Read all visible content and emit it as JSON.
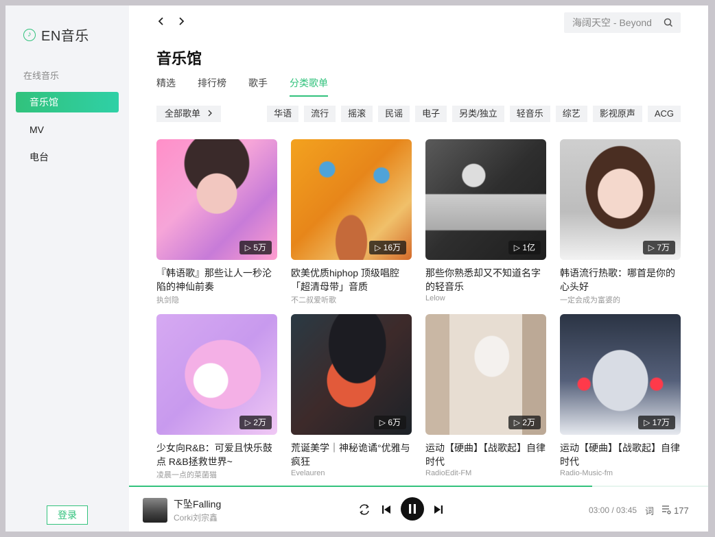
{
  "app": {
    "name": "EN音乐",
    "logo_icon": "music-note-icon"
  },
  "sidebar": {
    "section_label": "在线音乐",
    "items": [
      {
        "label": "音乐馆",
        "active": true
      },
      {
        "label": "MV",
        "active": false
      },
      {
        "label": "电台",
        "active": false
      }
    ],
    "login_label": "登录"
  },
  "header": {
    "back_icon": "chevron-left-icon",
    "forward_icon": "chevron-right-icon",
    "search_placeholder": "海阔天空 - Beyond",
    "search_icon": "search-icon"
  },
  "page": {
    "title": "音乐馆",
    "tabs": [
      {
        "label": "精选",
        "active": false
      },
      {
        "label": "排行榜",
        "active": false
      },
      {
        "label": "歌手",
        "active": false
      },
      {
        "label": "分类歌单",
        "active": true
      }
    ],
    "all_button_label": "全部歌单",
    "tags": [
      "华语",
      "流行",
      "摇滚",
      "民谣",
      "电子",
      "另类/独立",
      "轻音乐",
      "综艺",
      "影视原声",
      "ACG"
    ]
  },
  "playlists": [
    {
      "title": "『韩语歌』那些让人一秒沦陷的神仙前奏",
      "author": "执剑隐",
      "plays": "5万"
    },
    {
      "title": "欧美优质hiphop 顶级唱腔「超清母带」音质",
      "author": "不二叔爱听歌",
      "plays": "16万"
    },
    {
      "title": "那些你熟悉却又不知道名字的轻音乐",
      "author": "Lelow",
      "plays": "1亿"
    },
    {
      "title": "韩语流行热歌：哪首是你的心头好",
      "author": "一定会成为富婆的",
      "plays": "7万"
    },
    {
      "title": "少女向R&B：可爱且快乐鼓点 R&B拯救世界~",
      "author": "凌晨一点的菜菌猫",
      "plays": "2万"
    },
    {
      "title": "荒诞美学｜神秘诡谲°优雅与疯狂",
      "author": "Evelauren",
      "plays": "6万"
    },
    {
      "title": "运动【硬曲】【战歌起】自律时代",
      "author": "RadioEdit-FM",
      "plays": "2万"
    },
    {
      "title": "运动【硬曲】【战歌起】自律时代",
      "author": "Radio-Music-fm",
      "plays": "17万"
    }
  ],
  "player": {
    "song_title": "下坠Falling",
    "artist": "Corki刘宗鑫",
    "current_time": "03:00",
    "total_time": "03:45",
    "time_display": "03:00 / 03:45",
    "progress": 0.8,
    "lyric_label": "词",
    "queue_count": "177",
    "icons": [
      "repeat-icon",
      "previous-icon",
      "pause-icon",
      "next-icon",
      "playlist-icon"
    ]
  }
}
